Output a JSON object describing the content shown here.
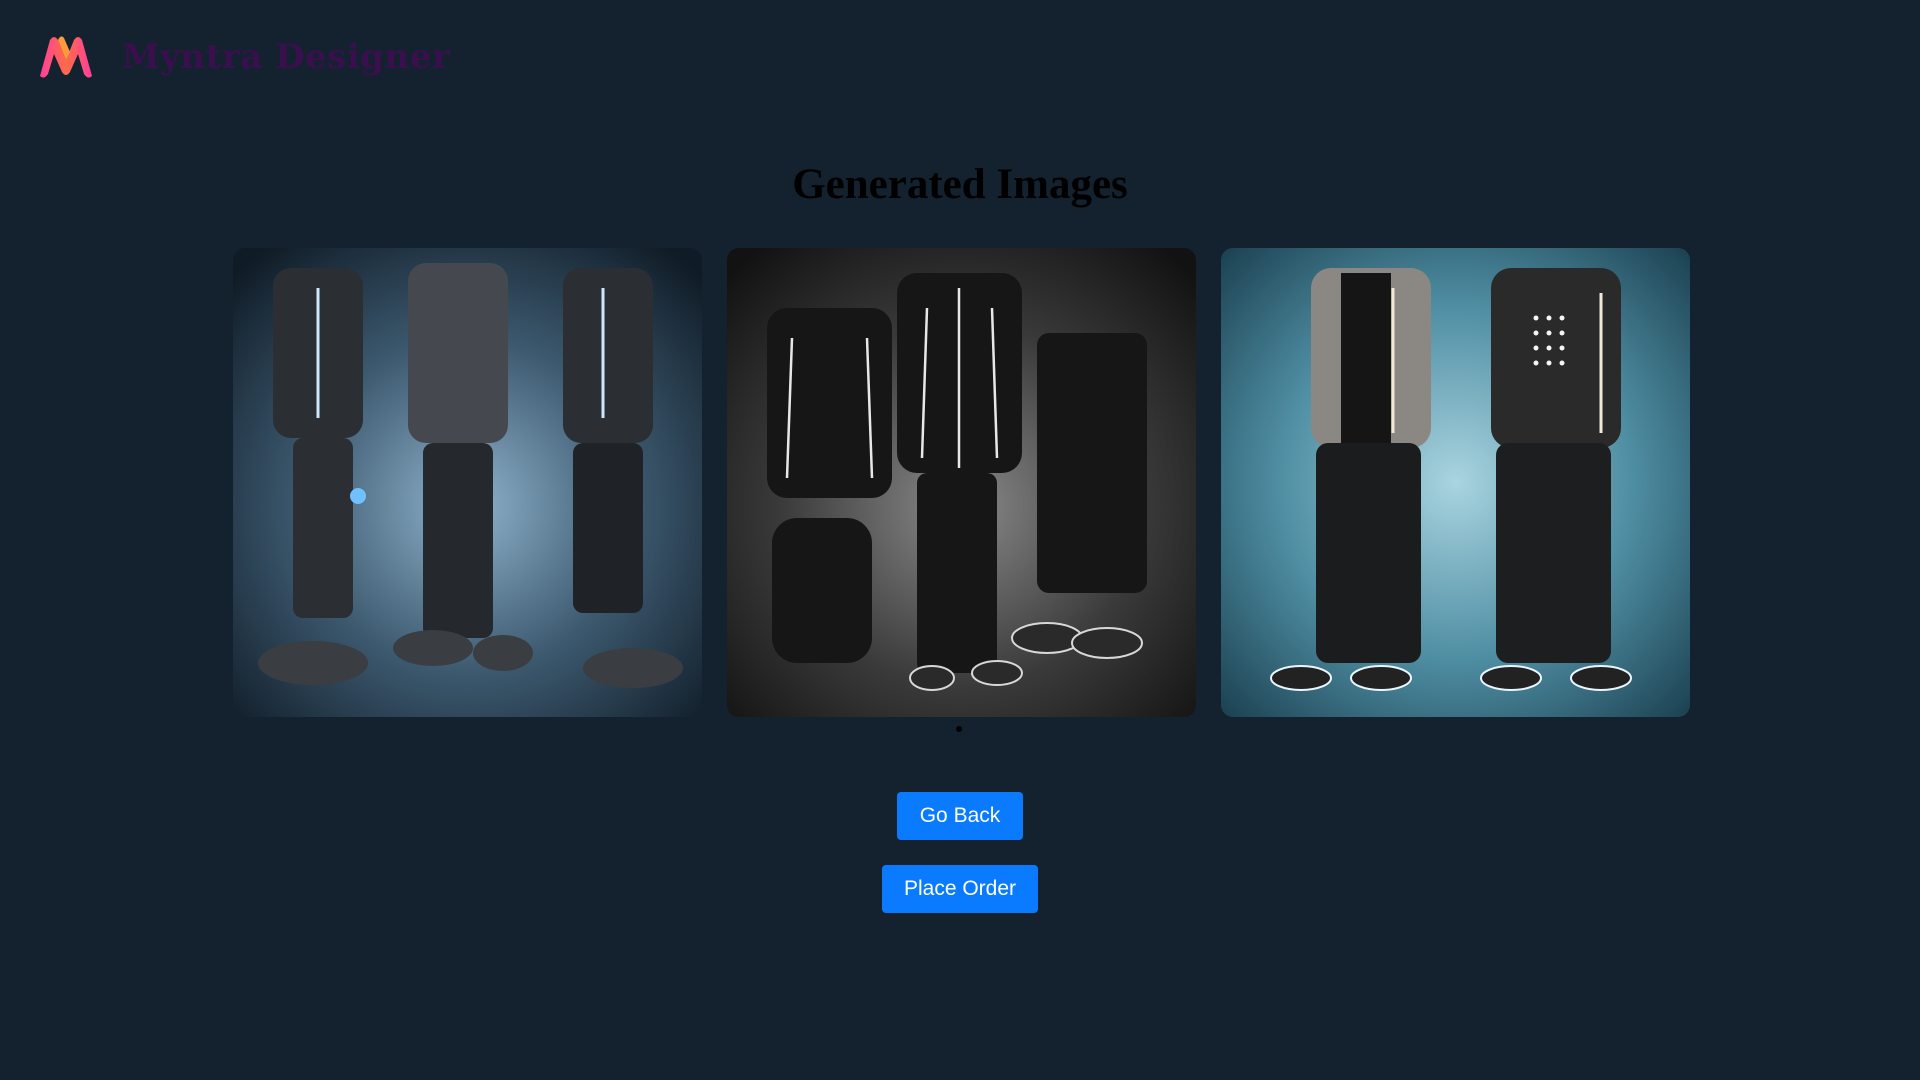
{
  "header": {
    "brand": "Myntra Designer",
    "logo_icon": "myntra-m-logo"
  },
  "main": {
    "title": "Generated Images",
    "images": [
      {
        "name": "outfit-image-1"
      },
      {
        "name": "outfit-image-2"
      },
      {
        "name": "outfit-image-3"
      }
    ],
    "carousel_pages": 1
  },
  "buttons": {
    "go_back": "Go Back",
    "place_order": "Place Order"
  },
  "colors": {
    "background": "#13222e",
    "brand_text": "#3a0f4e",
    "button": "#0a7bff",
    "logo_pink": "#ff3f6c",
    "logo_orange": "#ff9a3c"
  }
}
